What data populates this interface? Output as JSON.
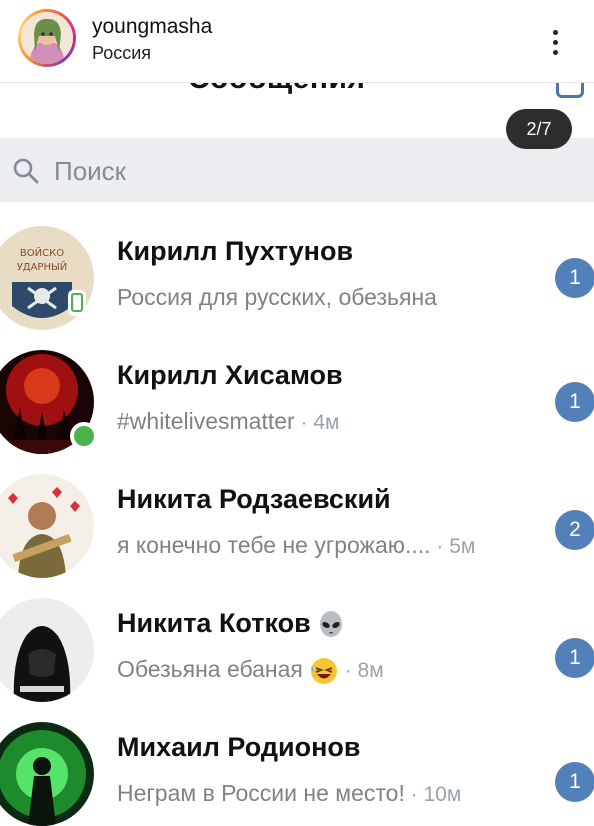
{
  "post": {
    "username": "youngmasha",
    "location": "Россия",
    "menu_icon": "kebab-icon"
  },
  "vk": {
    "title": "Сообщения",
    "page_indicator": "2/7",
    "search_placeholder": "Поиск",
    "colors": {
      "accent": "#4a76a8",
      "badge": "#5181b8",
      "online": "#4bb34b",
      "search_bg": "#ebedf0"
    }
  },
  "conversations": [
    {
      "name": "Кирилл Пухтунов",
      "message": "Россия для русских, обезьяна",
      "time": "",
      "unread": "1",
      "online": "mobile"
    },
    {
      "name": "Кирилл Хисамов",
      "message": "#whitelivesmatter",
      "time": " · 4м",
      "unread": "1",
      "online": "dot"
    },
    {
      "name": "Никита Родзаевский",
      "message": "я конечно тебе не угрожаю....",
      "time": " · 5м",
      "unread": "2",
      "online": "none"
    },
    {
      "name": "Никита Котков",
      "message": "Обезьяна ебаная",
      "time": " · 8м",
      "unread": "1",
      "online": "none",
      "name_emoji": "alien-emoji",
      "msg_emoji": "laughing-emoji"
    },
    {
      "name": "Михаил Родионов",
      "message": "Неграм в России не место!",
      "time": " · 10м",
      "unread": "1",
      "online": "none"
    }
  ]
}
